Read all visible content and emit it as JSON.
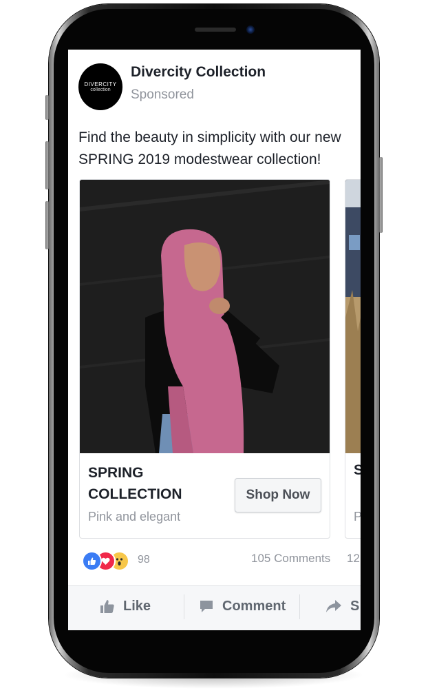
{
  "post": {
    "avatar_text_line1": "DIVERCITY",
    "avatar_text_line2": "collection",
    "page_name": "Divercity Collection",
    "sponsored_label": "Sponsored",
    "caption_line1": "Find the beauty in simplicity with our new",
    "caption_line2": "SPRING 2019 modestwear collection!"
  },
  "carousel": {
    "cards": [
      {
        "title_line1": "SPRING",
        "title_line2": "COLLECTION",
        "subtitle": "Pink and elegant",
        "button_label": "Shop Now"
      },
      {
        "title_partial": "S",
        "subtitle_partial": "P"
      }
    ]
  },
  "engagement": {
    "reaction_count": "98",
    "comments_label": "105 Comments",
    "shares_partial": "12",
    "reaction_icons": [
      "like-icon",
      "love-icon",
      "wow-icon"
    ]
  },
  "actions": {
    "like_label": "Like",
    "comment_label": "Comment",
    "share_partial": "S"
  },
  "colors": {
    "text_primary": "#1d2129",
    "text_secondary": "#90949c",
    "like_blue": "#3b7cf4",
    "love_red": "#f0284a",
    "wow_yellow": "#f7c74a",
    "hijab_pink": "#c6688f"
  }
}
